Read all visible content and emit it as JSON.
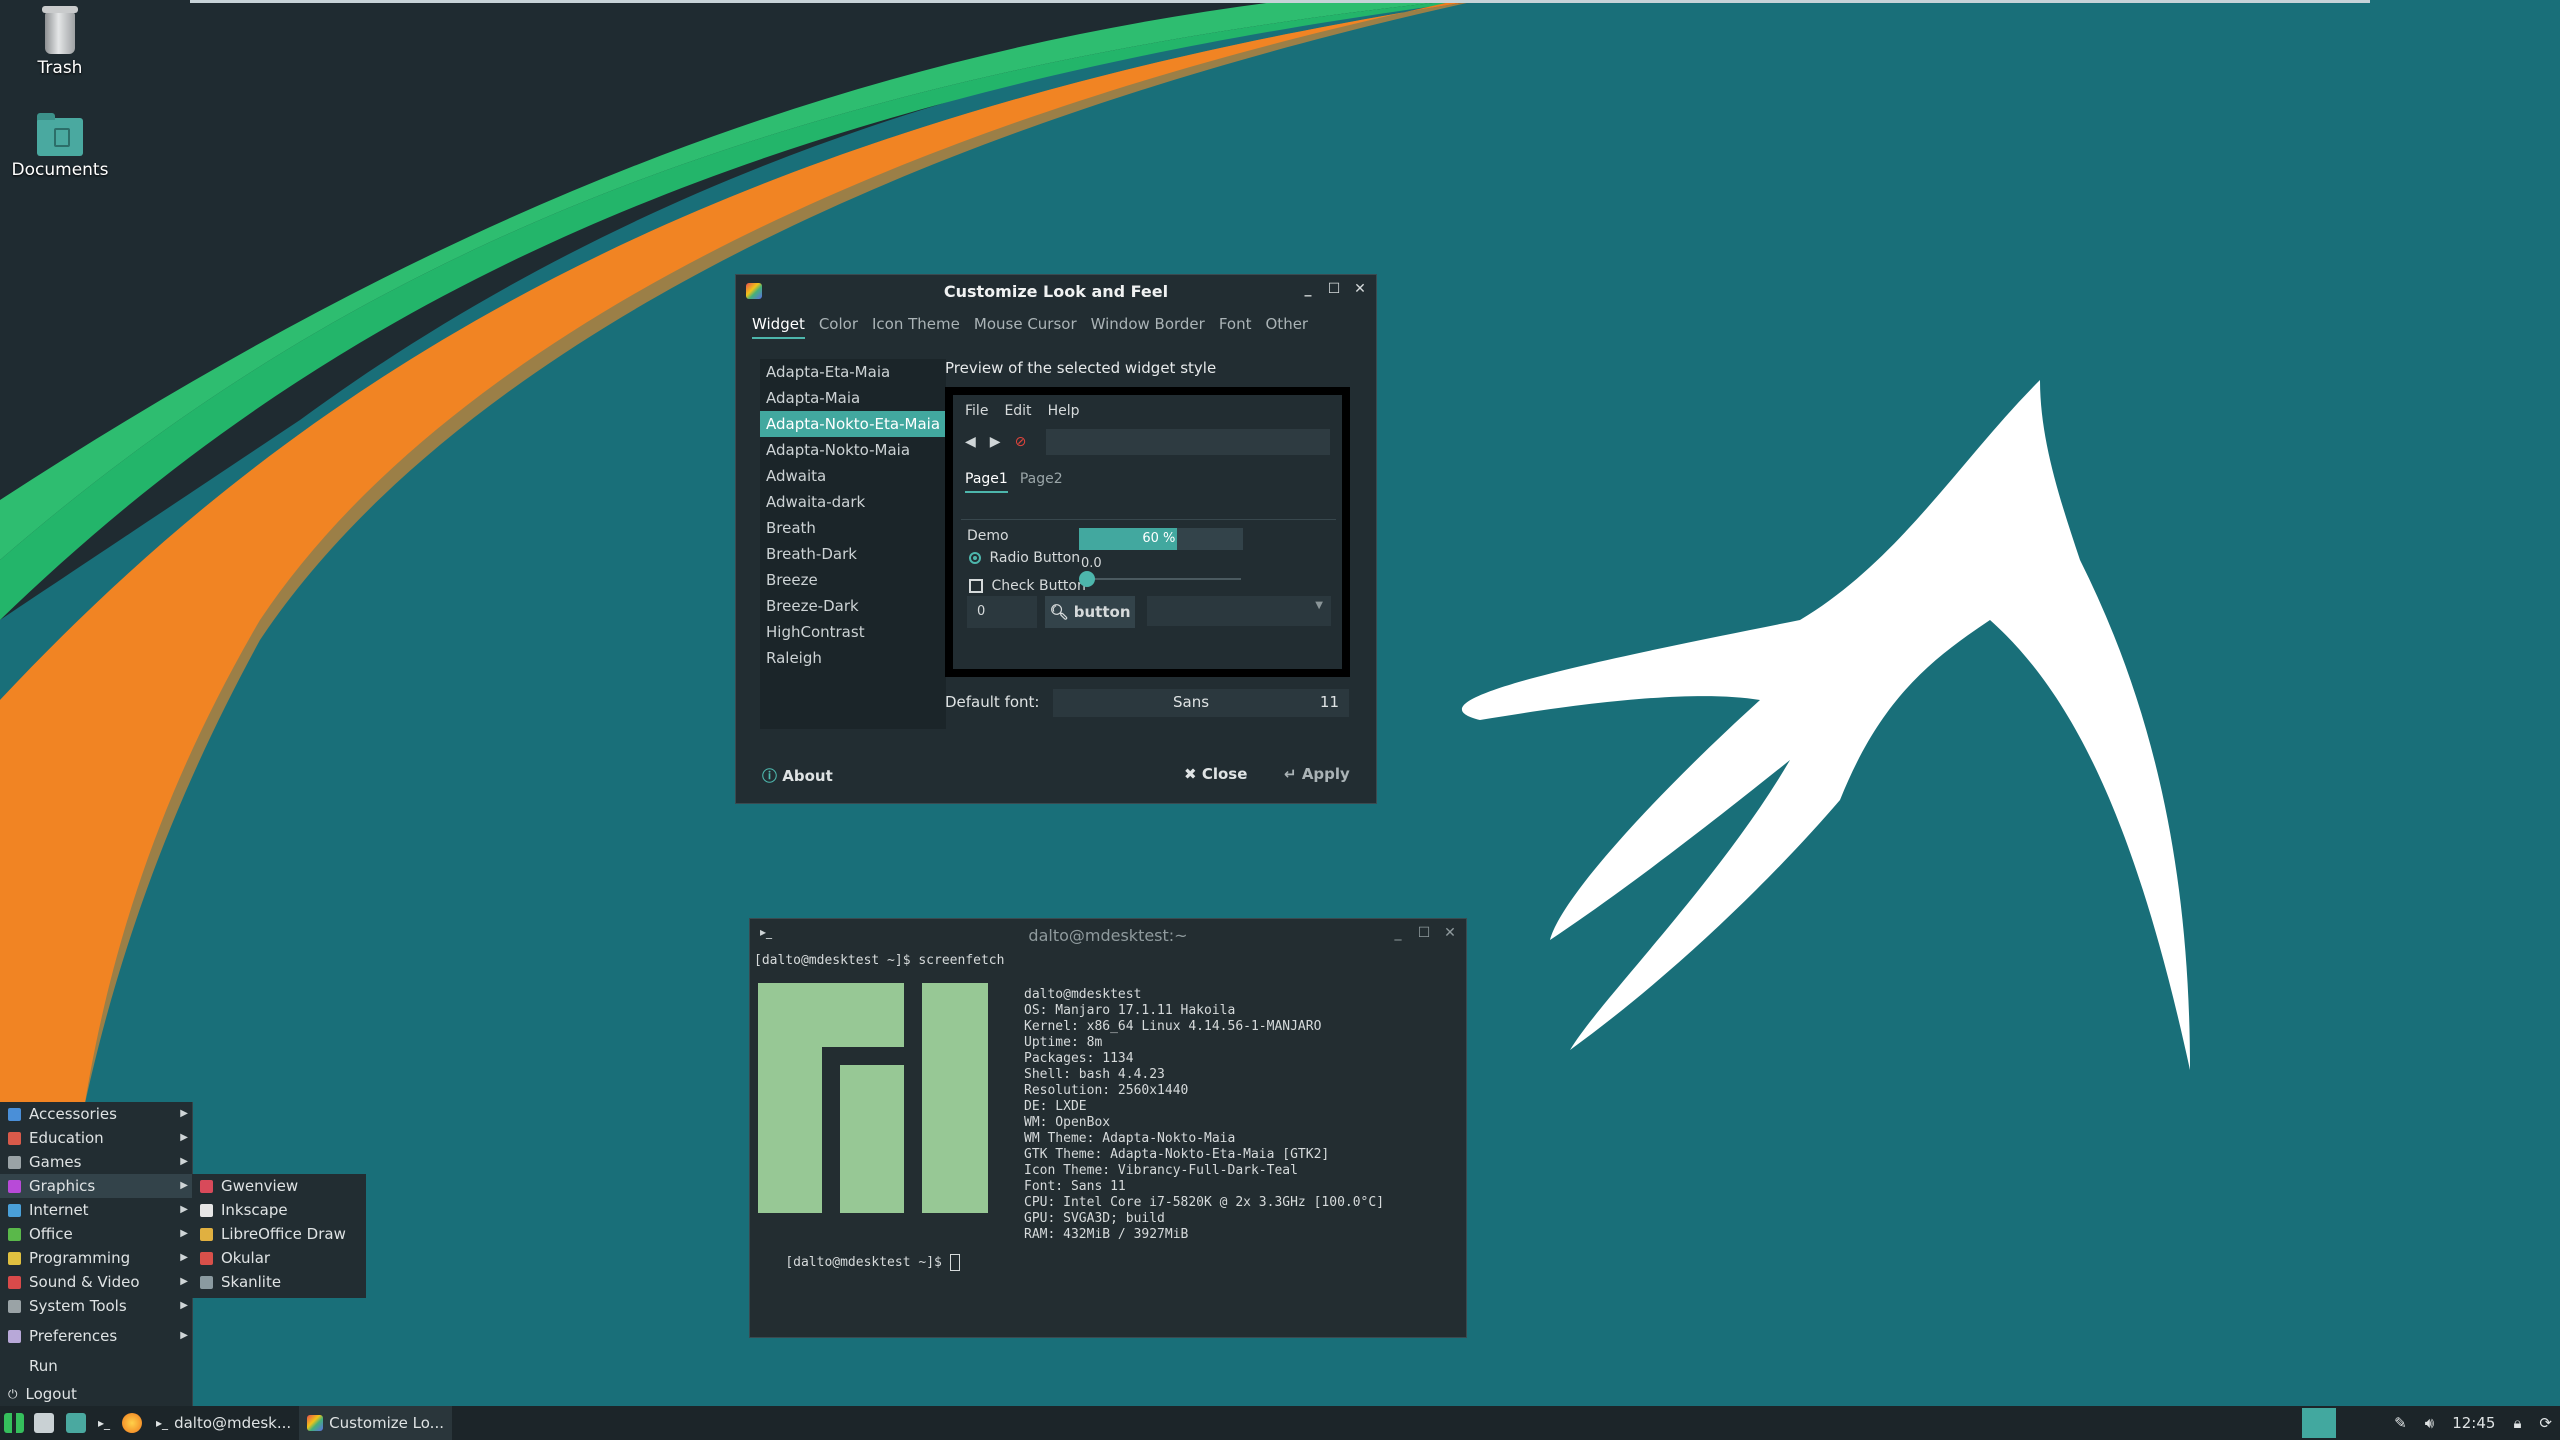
{
  "colors": {
    "accent": "#42a89f",
    "wallpaper": "#196f79",
    "panel": "#222d32"
  },
  "desktop": {
    "icons": [
      {
        "label": "Trash",
        "icon": "trash-icon"
      },
      {
        "label": "Documents",
        "icon": "folder-icon"
      }
    ]
  },
  "laf": {
    "title": "Customize Look and Feel",
    "tabs": [
      "Widget",
      "Color",
      "Icon Theme",
      "Mouse Cursor",
      "Window Border",
      "Font",
      "Other"
    ],
    "themes": [
      "Adapta-Eta-Maia",
      "Adapta-Maia",
      "Adapta-Nokto-Eta-Maia",
      "Adapta-Nokto-Maia",
      "Adwaita",
      "Adwaita-dark",
      "Breath",
      "Breath-Dark",
      "Breeze",
      "Breeze-Dark",
      "HighContrast",
      "Raleigh"
    ],
    "selected_theme": "Adapta-Nokto-Eta-Maia",
    "preview_label": "Preview of the selected widget style",
    "preview": {
      "menu": [
        "File",
        "Edit",
        "Help"
      ],
      "tabs": [
        "Page1",
        "Page2"
      ],
      "demo": "Demo",
      "progress_label": "60 %",
      "progress_value": 0.6,
      "radio": "Radio Button",
      "check": "Check Button",
      "scale_value": "0.0",
      "spin_value": "0",
      "button": "button"
    },
    "font_label": "Default font:",
    "font_name": "Sans",
    "font_size": "11",
    "about": "About",
    "close": "Close",
    "apply": "Apply"
  },
  "terminal": {
    "title": "dalto@mdesktest:~",
    "prompt1": "[dalto@mdesktest ~]$ screenfetch",
    "prompt2": "[dalto@mdesktest ~]$ ",
    "info": [
      "dalto@mdesktest",
      "OS: Manjaro 17.1.11 Hakoila",
      "Kernel: x86_64 Linux 4.14.56-1-MANJARO",
      "Uptime: 8m",
      "Packages: 1134",
      "Shell: bash 4.4.23",
      "Resolution: 2560x1440",
      "DE: LXDE",
      "WM: OpenBox",
      "WM Theme: Adapta-Nokto-Maia",
      "GTK Theme: Adapta-Nokto-Eta-Maia [GTK2]",
      "Icon Theme: Vibrancy-Full-Dark-Teal",
      "Font: Sans 11",
      "CPU: Intel Core i7-5820K @ 2x 3.3GHz [100.0°C]",
      "GPU: SVGA3D; build",
      "RAM: 432MiB / 3927MiB"
    ]
  },
  "startmenu": {
    "items": [
      {
        "label": "Accessories",
        "color": "#4a8fd8"
      },
      {
        "label": "Education",
        "color": "#d85a4a"
      },
      {
        "label": "Games",
        "color": "#9aa3a6"
      },
      {
        "label": "Graphics",
        "color": "#b84ad8"
      },
      {
        "label": "Internet",
        "color": "#4aa0d8"
      },
      {
        "label": "Office",
        "color": "#5ab84a"
      },
      {
        "label": "Programming",
        "color": "#e0c040"
      },
      {
        "label": "Sound & Video",
        "color": "#d84a4a"
      },
      {
        "label": "System Tools",
        "color": "#9aa3a6"
      },
      {
        "label": "Preferences",
        "color": "#b8a8d8"
      }
    ],
    "run": "Run",
    "logout": "Logout",
    "graphics_sub": [
      {
        "label": "Gwenview",
        "color": "#d84a5a"
      },
      {
        "label": "Inkscape",
        "color": "#e6e6e6"
      },
      {
        "label": "LibreOffice Draw",
        "color": "#e0b040"
      },
      {
        "label": "Okular",
        "color": "#d8504a"
      },
      {
        "label": "Skanlite",
        "color": "#8a9aa0"
      }
    ]
  },
  "taskbar": {
    "tasks": [
      {
        "label": "dalto@mdesk...",
        "icon": "terminal-icon"
      },
      {
        "label": "Customize Lo...",
        "icon": "appearance-icon"
      }
    ],
    "clock": "12:45"
  }
}
